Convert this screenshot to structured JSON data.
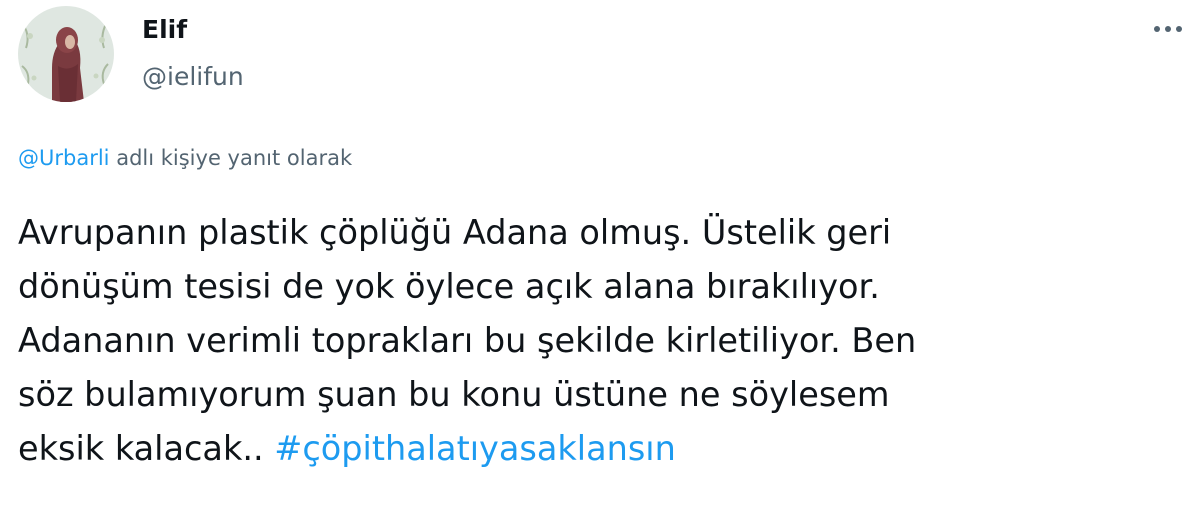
{
  "author": {
    "display_name": "Elif",
    "handle": "@ielifun",
    "avatar_icon": "user-avatar-photo"
  },
  "more_menu": {
    "icon": "more-horizontal-icon"
  },
  "reply_context": {
    "mention": "@Urbarli",
    "suffix": "adlı kişiye yanıt olarak"
  },
  "tweet": {
    "lines": [
      "Avrupanın plastik çöplüğü Adana olmuş. Üstelik geri",
      "dönüşüm tesisi de yok öylece açık alana bırakılıyor.",
      "Adananın verimli toprakları bu şekilde kirletiliyor. Ben",
      "söz bulamıyorum şuan bu konu üstüne ne söylesem",
      "eksik kalacak.."
    ],
    "hashtag": "#çöpithalatıyasaklansın"
  },
  "colors": {
    "text_primary": "#0f1419",
    "text_secondary": "#536471",
    "link_blue": "#1d9bf0"
  }
}
